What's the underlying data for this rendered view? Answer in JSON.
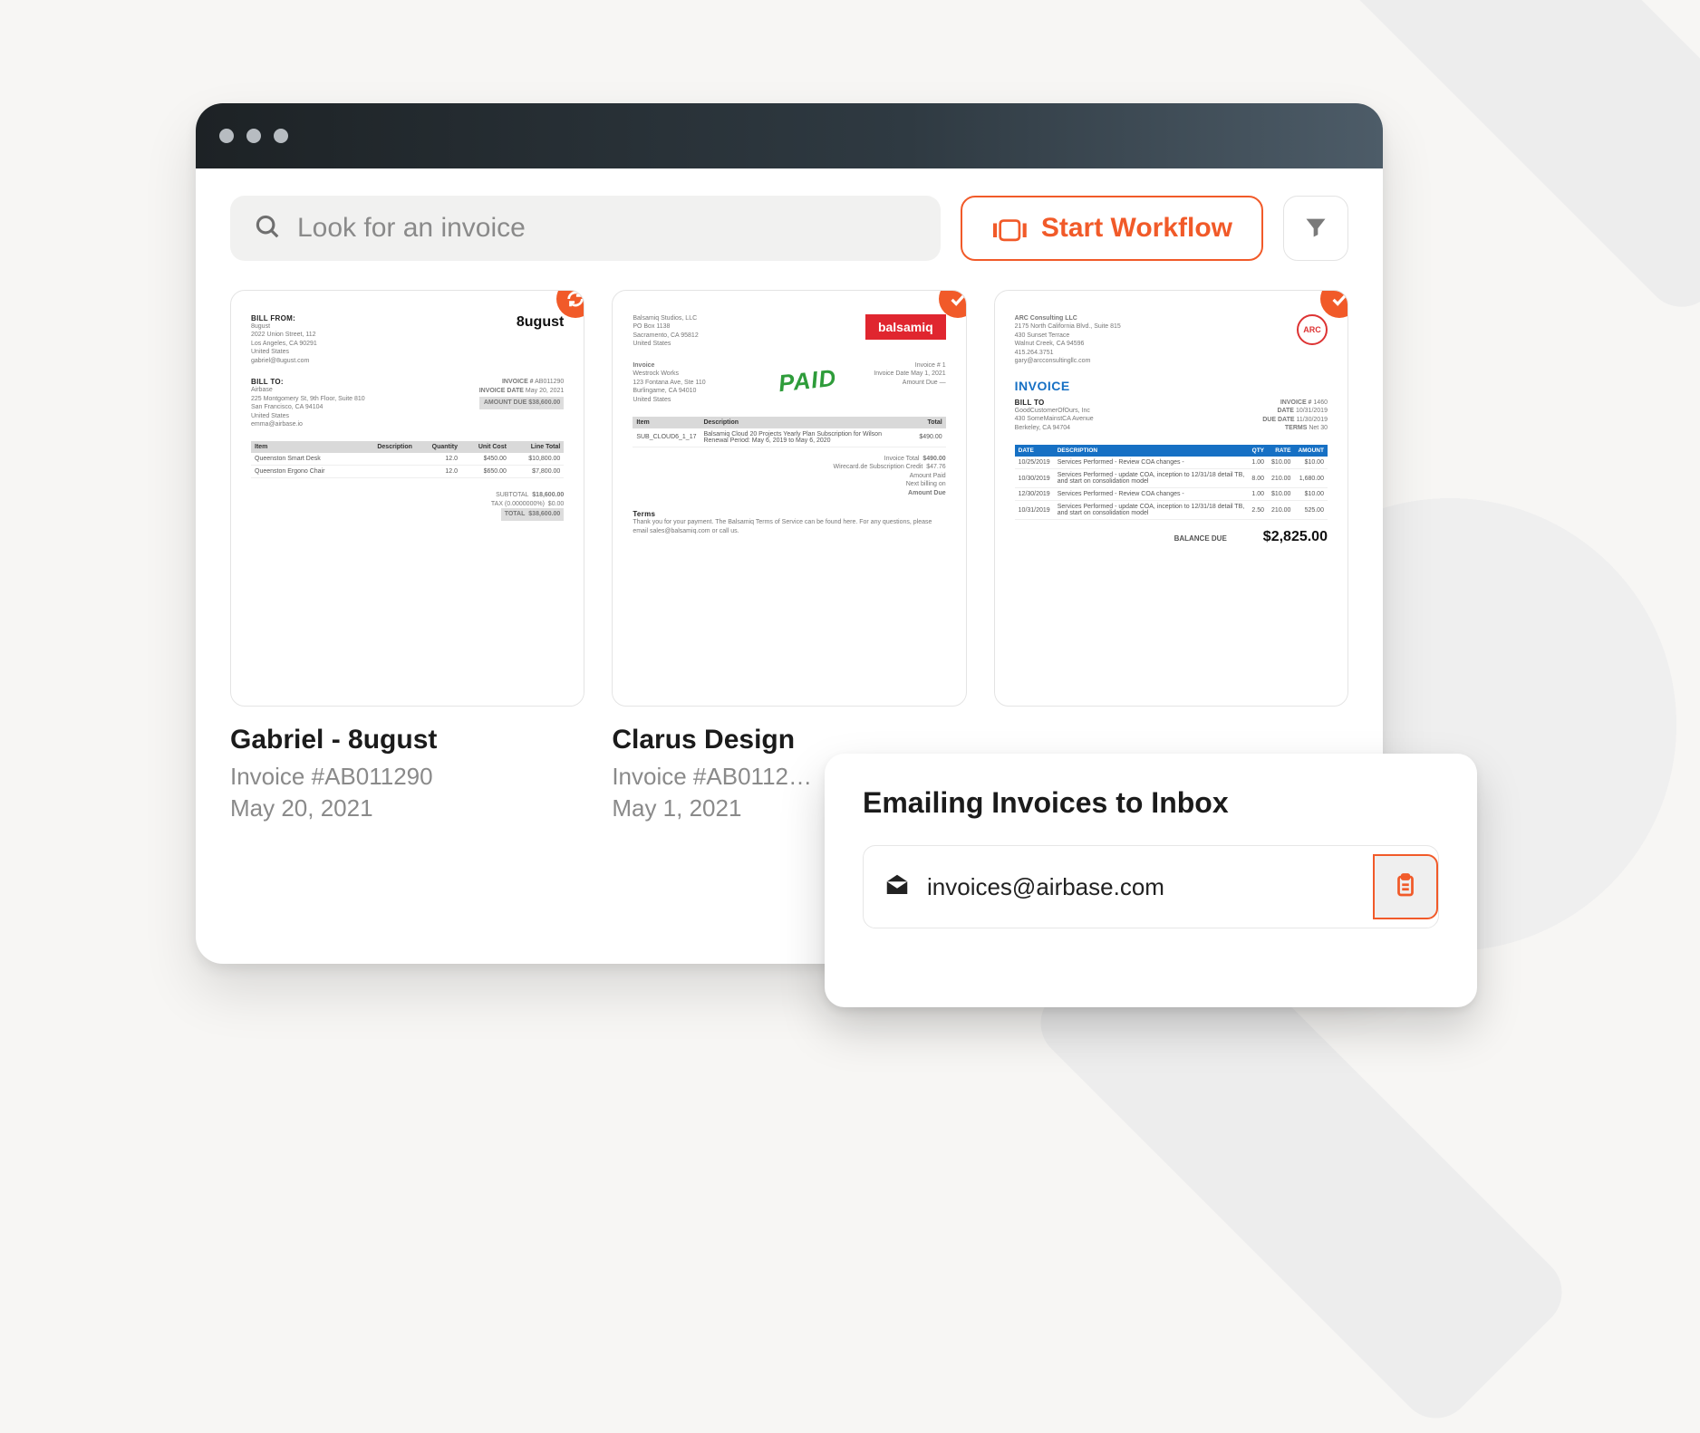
{
  "search": {
    "placeholder": "Look for an invoice"
  },
  "toolbar": {
    "workflow_label": "Start Workflow"
  },
  "invoices": [
    {
      "title": "Gabriel - 8ugust",
      "number": "Invoice #AB011290",
      "date": "May 20, 2021",
      "badge": "sync",
      "preview": {
        "brand": "8ugust",
        "from_label": "BILL FROM:",
        "from_lines": [
          "8ugust",
          "2022 Union Street, 112",
          "Los Angeles, CA 90291",
          "United States",
          "gabriel@8ugust.com"
        ],
        "to_label": "BILL TO:",
        "to_lines": [
          "Airbase",
          "225 Montgomery St, 9th Floor, Suite 810",
          "San Francisco, CA 94104",
          "United States",
          "emma@airbase.io"
        ],
        "meta": {
          "invoice_no_label": "INVOICE #",
          "invoice_no": "AB011290",
          "date_label": "INVOICE DATE",
          "date": "May 20, 2021",
          "amount_due_label": "AMOUNT DUE",
          "amount_due": "$38,600.00"
        },
        "table": {
          "headers": [
            "Item",
            "Description",
            "Quantity",
            "Unit Cost",
            "Line Total"
          ],
          "rows": [
            [
              "Queenston Smart Desk",
              "",
              "12.0",
              "$450.00",
              "$10,800.00"
            ],
            [
              "Queenston Ergono Chair",
              "",
              "12.0",
              "$650.00",
              "$7,800.00"
            ]
          ]
        },
        "totals": {
          "subtotal_label": "SUBTOTAL",
          "subtotal": "$18,600.00",
          "tax_label": "TAX (0.0000000%)",
          "tax": "$0.00",
          "total_label": "TOTAL",
          "total": "$38,600.00"
        }
      }
    },
    {
      "title": "Clarus Design",
      "number": "Invoice #AB0112…",
      "date": "May 1, 2021",
      "badge": "check",
      "preview": {
        "brand": "balsamiq",
        "stamp": "PAID",
        "from_lines": [
          "Balsamiq Studios, LLC",
          "PO Box 1138",
          "Sacramento, CA 95812",
          "United States"
        ],
        "to_lines": [
          "Westrock Works",
          "123 Fontana Ave, Ste 110",
          "Burlingame, CA 94010",
          "United States"
        ],
        "meta": {
          "inv_label": "Invoice #",
          "inv": "1",
          "date_label": "Invoice Date",
          "date": "May 1, 2021",
          "due_label": "Amount Due",
          "due": "—"
        },
        "table": {
          "headers": [
            "Item",
            "Description",
            "",
            "",
            "Total"
          ],
          "rows": [
            [
              "SUB_CLOUD6_1_17",
              "Balsamiq Cloud 20 Projects Yearly Plan Subscription for Wilson Renewal Period: May 6, 2019 to May 6, 2020",
              "",
              "",
              "$490.00"
            ]
          ]
        },
        "footer": {
          "lines": [
            "Invoice Total",
            "Wirecard.de Subscription Credit",
            "Amount Paid",
            "Next billing on",
            "Amount Due"
          ],
          "vals": [
            "$490.00",
            "$47.76",
            "—",
            "—",
            "—"
          ]
        },
        "terms_label": "Terms",
        "terms": "Thank you for your payment. The Balsamiq Terms of Service can be found here. For any questions, please email sales@balsamiq.com or call us."
      }
    },
    {
      "title": "",
      "number": "",
      "date": "",
      "badge": "check",
      "preview": {
        "company": [
          "ARC Consulting LLC",
          "2175 North California Blvd., Suite 815",
          "430 Sunset Terrace",
          "Walnut Creek, CA 94596",
          "415.264.3751",
          "gary@arcconsultingllc.com"
        ],
        "invoice_word": "INVOICE",
        "billto_label": "BILL TO",
        "billto": [
          "GoodCustomerOfOurs, Inc",
          "430 SomeMainstCA Avenue",
          "Berkeley, CA 94704"
        ],
        "meta": {
          "num_label": "INVOICE #",
          "num": "1460",
          "date_label": "DATE",
          "date": "10/31/2019",
          "due_label": "DUE DATE",
          "due": "11/30/2019",
          "terms_label": "TERMS",
          "terms": "Net 30"
        },
        "table": {
          "headers": [
            "DATE",
            "DESCRIPTION",
            "QTY",
            "RATE",
            "AMOUNT"
          ],
          "rows": [
            [
              "10/25/2019",
              "Services Performed - Review COA changes -",
              "1.00",
              "$10.00",
              "$10.00"
            ],
            [
              "10/30/2019",
              "Services Performed - update COA, inception to 12/31/18 detail TB, and start on consolidation model",
              "8.00",
              "210.00",
              "1,680.00"
            ],
            [
              "12/30/2019",
              "Services Performed - Review COA changes -",
              "1.00",
              "$10.00",
              "$10.00"
            ],
            [
              "10/31/2019",
              "Services Performed - update COA, inception to 12/31/18 detail TB, and start on consolidation model",
              "2.50",
              "210.00",
              "525.00"
            ]
          ]
        },
        "balance_label": "BALANCE DUE",
        "balance": "$2,825.00"
      }
    }
  ],
  "email_panel": {
    "heading": "Emailing Invoices to Inbox",
    "address": "invoices@airbase.com"
  }
}
